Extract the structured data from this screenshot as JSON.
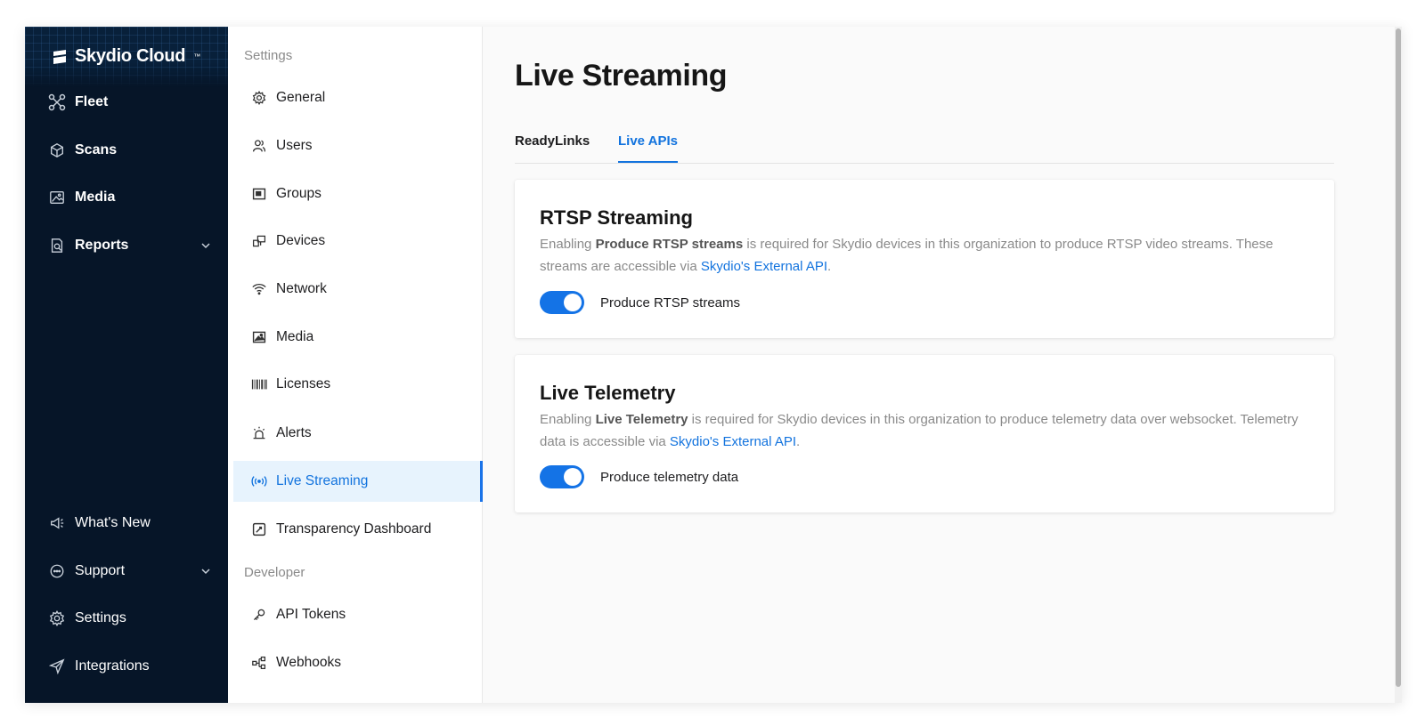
{
  "brand": {
    "name": "Skydio Cloud",
    "mark": "™"
  },
  "sidebar": {
    "items": [
      {
        "label": "Fleet",
        "icon": "drone-icon"
      },
      {
        "label": "Scans",
        "icon": "cube-icon"
      },
      {
        "label": "Media",
        "icon": "image-icon"
      },
      {
        "label": "Reports",
        "icon": "report-icon"
      }
    ],
    "bottom_items": [
      {
        "label": "What's New",
        "icon": "megaphone-icon"
      },
      {
        "label": "Support",
        "icon": "chat-icon"
      },
      {
        "label": "Settings",
        "icon": "gear-icon"
      },
      {
        "label": "Integrations",
        "icon": "send-icon"
      }
    ]
  },
  "settings": {
    "section_settings": "Settings",
    "items": [
      {
        "label": "General",
        "icon": "gear-icon"
      },
      {
        "label": "Users",
        "icon": "users-icon"
      },
      {
        "label": "Groups",
        "icon": "groups-icon"
      },
      {
        "label": "Devices",
        "icon": "devices-icon"
      },
      {
        "label": "Network",
        "icon": "wifi-icon"
      },
      {
        "label": "Media",
        "icon": "image-icon"
      },
      {
        "label": "Licenses",
        "icon": "barcode-icon"
      },
      {
        "label": "Alerts",
        "icon": "alarm-icon"
      },
      {
        "label": "Live Streaming",
        "icon": "broadcast-icon"
      },
      {
        "label": "Transparency Dashboard",
        "icon": "dashboard-icon"
      }
    ],
    "section_developer": "Developer",
    "dev_items": [
      {
        "label": "API Tokens",
        "icon": "key-icon"
      },
      {
        "label": "Webhooks",
        "icon": "webhook-icon"
      }
    ]
  },
  "main": {
    "title": "Live Streaming",
    "tabs": [
      {
        "label": "ReadyLinks"
      },
      {
        "label": "Live APIs"
      }
    ],
    "cards": [
      {
        "title": "RTSP Streaming",
        "desc_pre": "Enabling ",
        "desc_bold": "Produce RTSP streams",
        "desc_post": " is required for Skydio devices in this organization to produce RTSP video streams. These streams are accessible via ",
        "desc_link": "Skydio's External API",
        "desc_end": ".",
        "toggle_label": "Produce RTSP streams"
      },
      {
        "title": "Live Telemetry",
        "desc_pre": "Enabling ",
        "desc_bold": "Live Telemetry",
        "desc_post": " is required for Skydio devices in this organization to produce telemetry data over websocket. Telemetry data is accessible via ",
        "desc_link": "Skydio's External API",
        "desc_end": ".",
        "toggle_label": "Produce telemetry data"
      }
    ]
  },
  "colors": {
    "sidebar": "#061528",
    "accent": "#1273de",
    "toggle": "#1473e6"
  }
}
